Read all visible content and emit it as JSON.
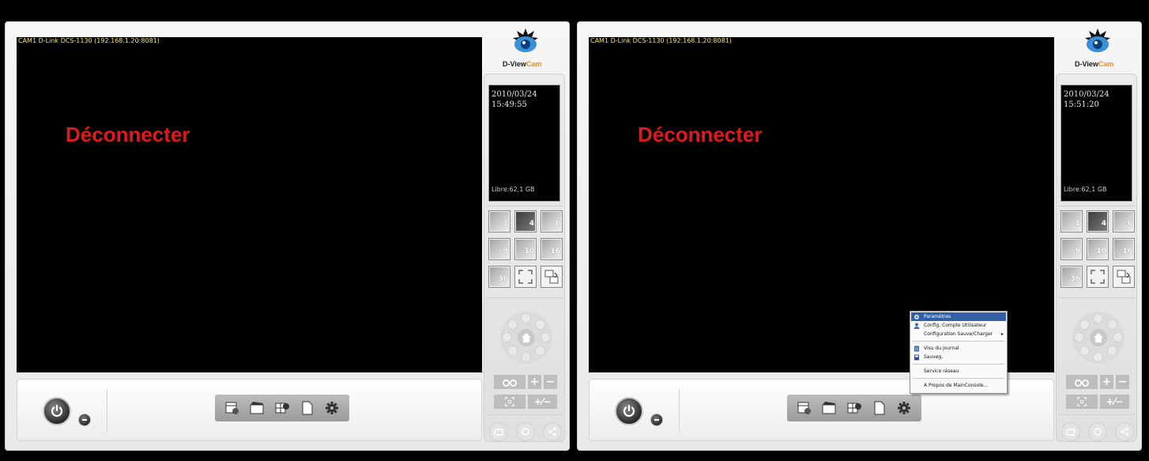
{
  "colors": {
    "disconnect": "#e01a1a",
    "cam_title": "#f5e36a",
    "logo_accent": "#f08a1c",
    "menu_highlight": "#3261a8"
  },
  "logo": {
    "brand_main": "D-View",
    "brand_accent": "Cam",
    "icon": "eye-logo-icon"
  },
  "windows": [
    {
      "camera_title": "CAM1 D-Link DCS-1130 (192.168.1.20:8081)",
      "status_text": "Déconnecter",
      "date": "2010/03/24",
      "time": "15:49:55",
      "free_space": "Libre:62,1 GB"
    },
    {
      "camera_title": "CAM1 D-Link DCS-1130 (192.168.1.20:8081)",
      "status_text": "Déconnecter",
      "date": "2010/03/24",
      "time": "15:51:20",
      "free_space": "Libre:62,1 GB",
      "context_menu": [
        {
          "label": "Paramètres",
          "icon": "settings-icon",
          "highlighted": true
        },
        {
          "label": "Config. Compte Utilisateur",
          "icon": "user-icon"
        },
        {
          "label": "Configuration Sauve/Charger",
          "icon": "",
          "submenu": true
        },
        {
          "label": "Visu du journal",
          "icon": "log-icon"
        },
        {
          "label": "Sauveg.",
          "icon": "backup-icon"
        },
        {
          "label": "Service réseau",
          "icon": ""
        },
        {
          "label": "A Propos de MainConsole...",
          "icon": ""
        }
      ]
    }
  ],
  "layout_buttons": [
    {
      "label": "1"
    },
    {
      "label": "4",
      "active": true
    },
    {
      "label": "6"
    },
    {
      "label": "9"
    },
    {
      "label": "10"
    },
    {
      "label": "16"
    },
    {
      "label": "36"
    },
    {
      "label": "",
      "icon": "fullscreen-icon"
    },
    {
      "label": "",
      "icon": "swap-screen-icon"
    }
  ],
  "toolbar_icons": [
    "record-schedule-icon",
    "playback-icon",
    "layout-config-icon",
    "document-icon",
    "gear-icon"
  ]
}
